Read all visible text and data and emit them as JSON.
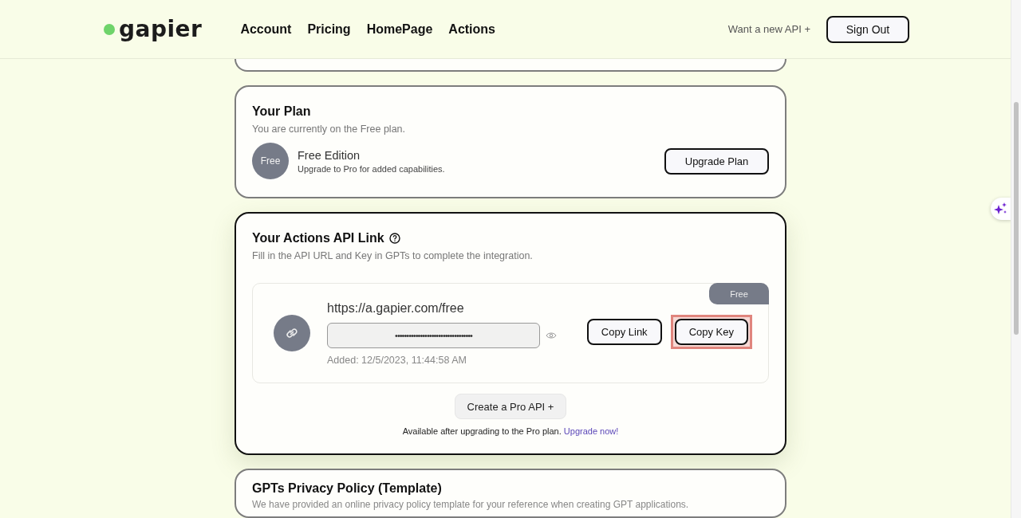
{
  "header": {
    "logo": "gapier",
    "nav": [
      {
        "label": "Account"
      },
      {
        "label": "Pricing"
      },
      {
        "label": "HomePage"
      },
      {
        "label": "Actions"
      }
    ],
    "new_api_link": "Want a new API +",
    "sign_out": "Sign Out"
  },
  "plan_card": {
    "title": "Your Plan",
    "subtitle": "You are currently on the Free plan.",
    "avatar": "Free",
    "edition": "Free Edition",
    "edition_note": "Upgrade to Pro for added capabilities.",
    "button": "Upgrade Plan"
  },
  "api_card": {
    "title": "Your Actions API Link",
    "subtitle": "Fill in the API URL and Key in GPTs to complete the integration.",
    "api": {
      "tag": "Free",
      "url": "https://a.gapier.com/free",
      "key": "••••••••••••••••••••••••••••••••••",
      "added": "Added: 12/5/2023, 11:44:58 AM",
      "buttons": [
        {
          "label": "Copy Link",
          "highlighted": false
        },
        {
          "label": "Copy Key",
          "highlighted": true
        }
      ]
    },
    "create_button": "Create a Pro API +",
    "note": "Available after upgrading to the Pro plan.",
    "note_link": "Upgrade now!"
  },
  "privacy_card": {
    "title": "GPTs Privacy Policy (Template)",
    "subtitle": "We have provided an online privacy policy template for your reference when creating GPT applications."
  }
}
